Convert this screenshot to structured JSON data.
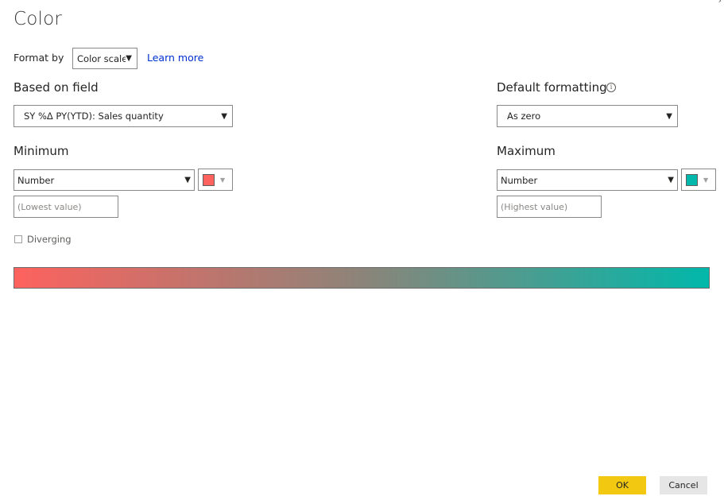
{
  "dialog": {
    "title": "Color",
    "corner_glyph": "›"
  },
  "format_by": {
    "label": "Format by",
    "value": "Color scale",
    "learn_more": "Learn more"
  },
  "based_on_field": {
    "label": "Based on field",
    "value": "SY %Δ PY(YTD): Sales quantity"
  },
  "default_formatting": {
    "label": "Default formatting",
    "info_icon": "info-icon",
    "value": "As zero"
  },
  "minimum": {
    "label": "Minimum",
    "type": "Number",
    "placeholder": "(Lowest value)",
    "color": "#fd625e"
  },
  "maximum": {
    "label": "Maximum",
    "type": "Number",
    "placeholder": "(Highest value)",
    "color": "#01b8aa"
  },
  "diverging": {
    "label": "Diverging",
    "checked": false
  },
  "buttons": {
    "ok": "OK",
    "cancel": "Cancel"
  },
  "colors": {
    "ok_button": "#f2c811",
    "link": "#0030d0"
  }
}
